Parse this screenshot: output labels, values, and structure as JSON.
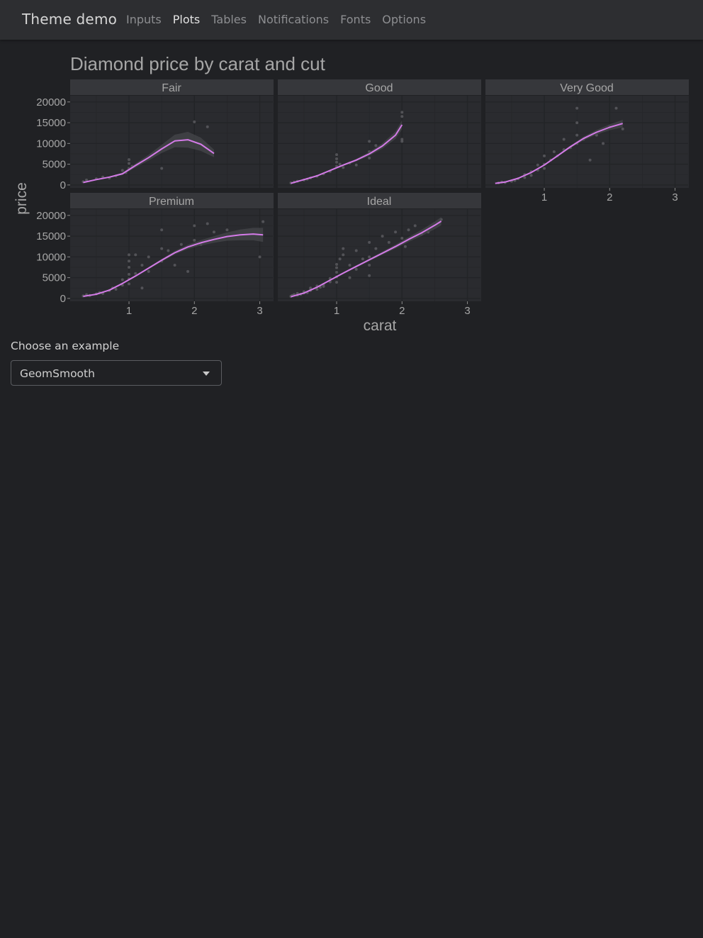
{
  "navbar": {
    "brand": "Theme demo",
    "items": [
      {
        "label": "Inputs",
        "active": false
      },
      {
        "label": "Plots",
        "active": true
      },
      {
        "label": "Tables",
        "active": false
      },
      {
        "label": "Notifications",
        "active": false
      },
      {
        "label": "Fonts",
        "active": false
      },
      {
        "label": "Options",
        "active": false
      }
    ]
  },
  "colors": {
    "background": "#202124",
    "navbar": "#2d2e31",
    "panel": "#2a2b2f",
    "strip": "#36373b",
    "grid": "#232427",
    "smooth_line": "#d47be8",
    "ribbon": "#46474b",
    "points": "#5a5b5f",
    "text": "#a6a6a6"
  },
  "chart_data": {
    "type": "scatter",
    "title": "Diamond price by carat and cut",
    "xlabel": "carat",
    "ylabel": "price",
    "xlim": [
      0.1,
      3.2
    ],
    "ylim": [
      -700,
      21500
    ],
    "xticks": [
      1,
      2,
      3
    ],
    "yticks": [
      0,
      5000,
      10000,
      15000,
      20000
    ],
    "grid": true,
    "layer": "smooth with confidence ribbon over points",
    "facets": [
      {
        "name": "Fair",
        "smooth": [
          [
            0.3,
            600
          ],
          [
            0.5,
            1300
          ],
          [
            0.7,
            1900
          ],
          [
            0.9,
            2700
          ],
          [
            1.1,
            4700
          ],
          [
            1.3,
            6600
          ],
          [
            1.5,
            8700
          ],
          [
            1.7,
            10600
          ],
          [
            1.9,
            10900
          ],
          [
            2.1,
            9800
          ],
          [
            2.3,
            7600
          ]
        ],
        "band": [
          0,
          0,
          150,
          300,
          500,
          700,
          1000,
          1500,
          1900,
          1600,
          900
        ],
        "points": [
          [
            0.3,
            800
          ],
          [
            0.35,
            1200
          ],
          [
            0.5,
            1500
          ],
          [
            0.6,
            1900
          ],
          [
            0.7,
            1700
          ],
          [
            0.8,
            2200
          ],
          [
            0.9,
            3500
          ],
          [
            0.95,
            3000
          ],
          [
            1.0,
            4000
          ],
          [
            1.0,
            5200
          ],
          [
            1.0,
            6100
          ],
          [
            1.05,
            4500
          ],
          [
            1.5,
            4000
          ],
          [
            2.0,
            15200
          ],
          [
            2.2,
            14000
          ]
        ]
      },
      {
        "name": "Good",
        "smooth": [
          [
            0.3,
            400
          ],
          [
            0.5,
            1300
          ],
          [
            0.7,
            2200
          ],
          [
            0.9,
            3500
          ],
          [
            1.1,
            4800
          ],
          [
            1.3,
            6000
          ],
          [
            1.5,
            7500
          ],
          [
            1.7,
            9400
          ],
          [
            1.9,
            12000
          ],
          [
            2.0,
            14500
          ]
        ],
        "band": [
          150,
          100,
          100,
          150,
          200,
          300,
          450,
          650,
          900,
          1100
        ],
        "points": [
          [
            0.3,
            500
          ],
          [
            0.35,
            700
          ],
          [
            0.4,
            900
          ],
          [
            0.5,
            1200
          ],
          [
            0.55,
            1400
          ],
          [
            0.6,
            1700
          ],
          [
            0.7,
            2100
          ],
          [
            0.8,
            2700
          ],
          [
            0.9,
            3300
          ],
          [
            1.0,
            4500
          ],
          [
            1.0,
            5500
          ],
          [
            1.0,
            6300
          ],
          [
            1.0,
            7300
          ],
          [
            1.05,
            5000
          ],
          [
            1.1,
            4200
          ],
          [
            1.2,
            5300
          ],
          [
            1.3,
            4800
          ],
          [
            1.5,
            6500
          ],
          [
            1.5,
            8000
          ],
          [
            1.5,
            10500
          ],
          [
            1.6,
            9500
          ],
          [
            2.0,
            11000
          ],
          [
            2.0,
            17500
          ],
          [
            2.0,
            16500
          ],
          [
            2.0,
            10500
          ]
        ]
      },
      {
        "name": "Very Good",
        "smooth": [
          [
            0.25,
            400
          ],
          [
            0.4,
            700
          ],
          [
            0.6,
            1600
          ],
          [
            0.8,
            3000
          ],
          [
            1.0,
            4800
          ],
          [
            1.2,
            7000
          ],
          [
            1.4,
            9200
          ],
          [
            1.6,
            11200
          ],
          [
            1.8,
            12700
          ],
          [
            2.0,
            13900
          ],
          [
            2.2,
            14800
          ]
        ],
        "band": [
          120,
          80,
          80,
          150,
          200,
          250,
          300,
          450,
          550,
          700,
          900
        ],
        "points": [
          [
            0.3,
            500
          ],
          [
            0.35,
            700
          ],
          [
            0.4,
            600
          ],
          [
            0.5,
            900
          ],
          [
            0.55,
            1100
          ],
          [
            0.6,
            1500
          ],
          [
            0.7,
            1800
          ],
          [
            0.7,
            2500
          ],
          [
            0.8,
            2300
          ],
          [
            0.8,
            3200
          ],
          [
            0.9,
            3600
          ],
          [
            0.9,
            4800
          ],
          [
            1.0,
            5000
          ],
          [
            1.0,
            7000
          ],
          [
            1.0,
            4000
          ],
          [
            1.1,
            6000
          ],
          [
            1.15,
            8000
          ],
          [
            1.2,
            7000
          ],
          [
            1.3,
            8500
          ],
          [
            1.3,
            11000
          ],
          [
            1.4,
            9000
          ],
          [
            1.5,
            10000
          ],
          [
            1.5,
            12000
          ],
          [
            1.5,
            15000
          ],
          [
            1.5,
            18500
          ],
          [
            1.6,
            11000
          ],
          [
            1.7,
            6000
          ],
          [
            1.8,
            12000
          ],
          [
            1.9,
            10000
          ],
          [
            2.0,
            14000
          ],
          [
            2.1,
            18500
          ],
          [
            2.2,
            13500
          ]
        ]
      },
      {
        "name": "Premium",
        "smooth": [
          [
            0.3,
            500
          ],
          [
            0.5,
            1000
          ],
          [
            0.7,
            2000
          ],
          [
            0.9,
            3600
          ],
          [
            1.1,
            5400
          ],
          [
            1.3,
            7300
          ],
          [
            1.5,
            9200
          ],
          [
            1.7,
            11000
          ],
          [
            1.9,
            12400
          ],
          [
            2.1,
            13400
          ],
          [
            2.3,
            14200
          ],
          [
            2.5,
            14900
          ],
          [
            2.7,
            15300
          ],
          [
            2.9,
            15500
          ],
          [
            3.05,
            15300
          ]
        ],
        "band": [
          120,
          80,
          100,
          150,
          200,
          260,
          330,
          420,
          520,
          650,
          800,
          1000,
          1300,
          1500,
          1700
        ],
        "points": [
          [
            0.3,
            600
          ],
          [
            0.35,
            900
          ],
          [
            0.4,
            700
          ],
          [
            0.5,
            1100
          ],
          [
            0.55,
            1400
          ],
          [
            0.6,
            1200
          ],
          [
            0.7,
            1900
          ],
          [
            0.75,
            2500
          ],
          [
            0.8,
            2200
          ],
          [
            0.9,
            3200
          ],
          [
            0.9,
            4500
          ],
          [
            1.0,
            3500
          ],
          [
            1.0,
            4700
          ],
          [
            1.0,
            5800
          ],
          [
            1.0,
            7500
          ],
          [
            1.0,
            9000
          ],
          [
            1.0,
            10500
          ],
          [
            1.1,
            6000
          ],
          [
            1.1,
            10500
          ],
          [
            1.2,
            2500
          ],
          [
            1.2,
            8000
          ],
          [
            1.3,
            6500
          ],
          [
            1.3,
            10000
          ],
          [
            1.5,
            9000
          ],
          [
            1.5,
            12000
          ],
          [
            1.5,
            16500
          ],
          [
            1.6,
            11500
          ],
          [
            1.7,
            8000
          ],
          [
            1.8,
            13000
          ],
          [
            1.9,
            6500
          ],
          [
            2.0,
            14000
          ],
          [
            2.0,
            17500
          ],
          [
            2.1,
            13000
          ],
          [
            2.2,
            18000
          ],
          [
            2.3,
            16000
          ],
          [
            2.5,
            16500
          ],
          [
            3.0,
            10000
          ],
          [
            3.05,
            18500
          ]
        ]
      },
      {
        "name": "Ideal",
        "smooth": [
          [
            0.3,
            400
          ],
          [
            0.5,
            1300
          ],
          [
            0.7,
            2700
          ],
          [
            0.9,
            4400
          ],
          [
            1.1,
            6100
          ],
          [
            1.3,
            7700
          ],
          [
            1.5,
            9300
          ],
          [
            1.7,
            10900
          ],
          [
            1.9,
            12500
          ],
          [
            2.1,
            14200
          ],
          [
            2.3,
            15800
          ],
          [
            2.5,
            17600
          ],
          [
            2.6,
            18600
          ]
        ],
        "band": [
          100,
          80,
          120,
          180,
          220,
          260,
          300,
          380,
          480,
          600,
          750,
          900,
          1000
        ],
        "points": [
          [
            0.3,
            500
          ],
          [
            0.32,
            700
          ],
          [
            0.35,
            900
          ],
          [
            0.4,
            800
          ],
          [
            0.4,
            1200
          ],
          [
            0.45,
            1000
          ],
          [
            0.5,
            1300
          ],
          [
            0.5,
            1600
          ],
          [
            0.55,
            1400
          ],
          [
            0.6,
            1900
          ],
          [
            0.6,
            2500
          ],
          [
            0.7,
            2200
          ],
          [
            0.7,
            3000
          ],
          [
            0.75,
            2700
          ],
          [
            0.8,
            3400
          ],
          [
            0.8,
            2900
          ],
          [
            0.9,
            4000
          ],
          [
            0.9,
            4800
          ],
          [
            1.0,
            3900
          ],
          [
            1.0,
            5200
          ],
          [
            1.0,
            6300
          ],
          [
            1.0,
            7400
          ],
          [
            1.0,
            8200
          ],
          [
            1.05,
            9500
          ],
          [
            1.1,
            10500
          ],
          [
            1.1,
            12000
          ],
          [
            1.2,
            5000
          ],
          [
            1.2,
            8000
          ],
          [
            1.3,
            7000
          ],
          [
            1.3,
            11500
          ],
          [
            1.4,
            9500
          ],
          [
            1.5,
            5500
          ],
          [
            1.5,
            8000
          ],
          [
            1.5,
            10000
          ],
          [
            1.5,
            13500
          ],
          [
            1.6,
            12000
          ],
          [
            1.7,
            15000
          ],
          [
            1.8,
            13500
          ],
          [
            1.9,
            16000
          ],
          [
            2.0,
            14500
          ],
          [
            2.1,
            16500
          ],
          [
            2.05,
            12500
          ],
          [
            2.2,
            17500
          ],
          [
            2.3,
            15500
          ],
          [
            2.4,
            16000
          ],
          [
            2.6,
            19000
          ]
        ]
      }
    ]
  },
  "select": {
    "label": "Choose an example",
    "value": "GeomSmooth"
  }
}
